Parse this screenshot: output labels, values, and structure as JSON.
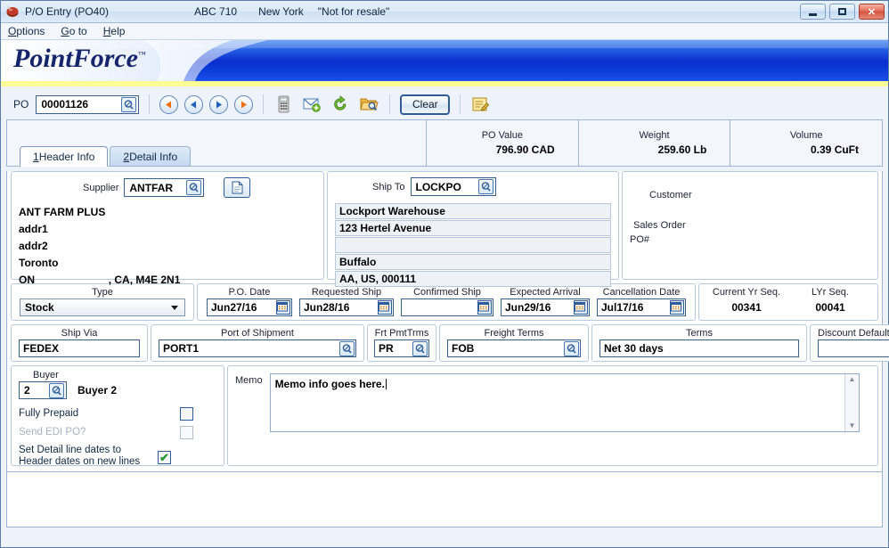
{
  "window": {
    "title": "P/O Entry (PO40)",
    "company_code": "ABC 710",
    "location": "New York",
    "notice": "\"Not for resale\"",
    "app_icon": "application-icon",
    "minimize_label": "–",
    "maximize_label": "□",
    "close_label": "✕"
  },
  "menu": {
    "items": [
      {
        "prefix": "O",
        "rest": "ptions"
      },
      {
        "prefix": "G",
        "rest": "o to"
      },
      {
        "prefix": "H",
        "rest": "elp"
      }
    ]
  },
  "branding": {
    "logo_text": "PointForce",
    "trademark": "™",
    "banner_blue": "#0033cc",
    "banner_yellow": "#fdfd96",
    "logo_color": "#16256b"
  },
  "toolbar": {
    "po_label": "PO",
    "po_value": "00001126",
    "po_placeholder": "",
    "lookup_icon": "magnifier-icon",
    "nav": [
      {
        "name": "first-record-button",
        "icon": "triangle-left-orange",
        "color": "#ef6c0b"
      },
      {
        "name": "previous-record-button",
        "icon": "triangle-left-blue",
        "color": "#1f5fbf"
      },
      {
        "name": "next-record-button",
        "icon": "triangle-right-blue",
        "color": "#1f5fbf"
      },
      {
        "name": "last-record-button",
        "icon": "triangle-right-orange",
        "color": "#ef6c0b"
      }
    ],
    "icons": [
      {
        "name": "calculator-icon",
        "label": "Calculator"
      },
      {
        "name": "email-add-icon",
        "label": "Email"
      },
      {
        "name": "refresh-icon",
        "label": "Refresh"
      },
      {
        "name": "folder-search-icon",
        "label": "Search Folder"
      }
    ],
    "clear_label": "Clear",
    "notes_icon": "notepad-edit-icon"
  },
  "summary": {
    "cells": [
      {
        "label": "PO Value",
        "value": "796.90 CAD"
      },
      {
        "label": "Weight",
        "value": "259.60 Lb"
      },
      {
        "label": "Volume",
        "value": "0.39 CuFt"
      }
    ]
  },
  "tabs": [
    {
      "num": "1",
      "label": " Header Info",
      "active": true
    },
    {
      "num": "2",
      "label": " Detail Info",
      "active": false
    }
  ],
  "supplier": {
    "label": "Supplier",
    "code": "ANTFAR",
    "doc_icon": "document-icon",
    "address": [
      "ANT FARM PLUS",
      "addr1",
      "addr2",
      "Toronto"
    ],
    "region": "ON",
    "region_rest": ", CA, M4E 2N1"
  },
  "ship_to": {
    "label": "Ship To",
    "code": "LOCKPO",
    "lines": [
      "Lockport Warehouse",
      "123 Hertel Avenue",
      "",
      "Buffalo",
      "AA, US, 000111"
    ]
  },
  "customer": {
    "customer_label": "Customer",
    "customer_value": "",
    "sales_order_label": "Sales Order",
    "sales_order_value": "",
    "po_number_label": "PO#",
    "po_number_value": ""
  },
  "dates": {
    "type_label": "Type",
    "type_value": "Stock",
    "fields": [
      {
        "name": "po-date",
        "label": "P.O. Date",
        "value": "Jun27/16",
        "calendar": true
      },
      {
        "name": "requested-ship",
        "label": "Requested Ship",
        "value": "Jun28/16",
        "calendar": true
      },
      {
        "name": "confirmed-ship",
        "label": "Confirmed Ship",
        "value": "",
        "calendar": true
      },
      {
        "name": "expected-arrival",
        "label": "Expected Arrival",
        "value": "Jun29/16",
        "calendar": true
      },
      {
        "name": "cancellation-date",
        "label": "Cancellation Date",
        "value": "Jul17/16",
        "calendar": true
      }
    ],
    "current_yr_seq_label": "Current Yr Seq.",
    "current_yr_seq_value": "00341",
    "lyr_seq_label": "LYr Seq.",
    "lyr_seq_value": "00041"
  },
  "shipping": {
    "ship_via_label": "Ship Via",
    "ship_via_value": "FEDEX",
    "port_label": "Port of Shipment",
    "port_value": "PORT1",
    "frt_pmt_label": "Frt PmtTrms",
    "frt_pmt_value": "PR",
    "freight_terms_label": "Freight Terms",
    "freight_terms_value": "FOB",
    "terms_label": "Terms",
    "terms_value": "Net 30 days",
    "discount_label": "Discount Default",
    "discount_value": ""
  },
  "buyer": {
    "label": "Buyer",
    "code": "2",
    "name": "Buyer 2",
    "checks": [
      {
        "name": "fully-prepaid",
        "label": "Fully Prepaid",
        "checked": false,
        "disabled": false
      },
      {
        "name": "send-edi-po",
        "label": "Send EDI PO?",
        "checked": false,
        "disabled": true
      },
      {
        "name": "set-detail-dates",
        "label": "Set Detail line dates to Header dates on new lines",
        "checked": true,
        "disabled": false
      }
    ],
    "check_glyph": "✔"
  },
  "memo": {
    "label": "Memo",
    "value": "Memo info goes here.",
    "scroll_up": "▲",
    "scroll_down": "▼"
  }
}
